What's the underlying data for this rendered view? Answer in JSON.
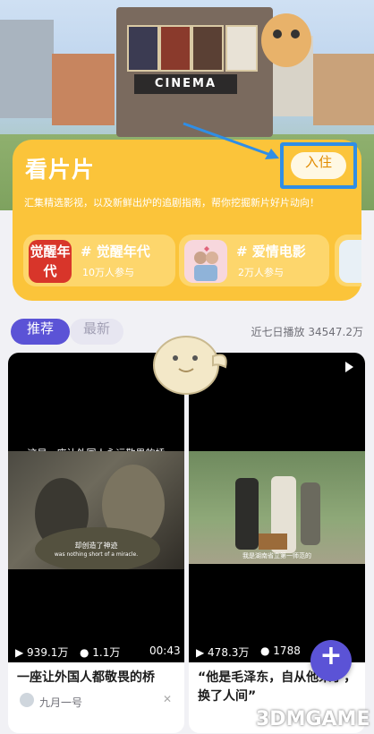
{
  "hero": {
    "building_sign": "CINEMA"
  },
  "card": {
    "title": "看片片",
    "join_label": "入住",
    "description": "汇集精选影视，以及新鲜出炉的追剧指南，帮你挖掘新片好片动向！",
    "topics": [
      {
        "thumb_text": "觉醒年代",
        "title": "# 觉醒年代",
        "subtitle": "10万人参与"
      },
      {
        "thumb_text": "",
        "title": "# 爱情电影",
        "subtitle": "2万人参与"
      }
    ]
  },
  "tabs": [
    {
      "label": "推荐"
    },
    {
      "label": "最新"
    }
  ],
  "stats": {
    "plays_7d": "近七日播放 34547.2万"
  },
  "videos": [
    {
      "overlay_title": "这是一座让外国人永远敬畏的桥",
      "subtitle_cn": "却创造了神迹",
      "subtitle_en": "was nothing short of a miracle.",
      "views": "939.1万",
      "comments": "1.1万",
      "duration": "00:43",
      "caption": "一座让外国人都敬畏的桥",
      "author": "九月一号"
    },
    {
      "subtitle_cn": "我是湖南省立第一师范的",
      "views": "478.3万",
      "comments": "1788",
      "caption": "“他是毛泽东，自从他来了，换了人间”"
    }
  ],
  "fab_label": "+",
  "watermark": "3DMGAME",
  "colors": {
    "accent": "#5b53d6",
    "card_yellow": "#fbc43a",
    "highlight_blue": "#2f8ee6"
  }
}
